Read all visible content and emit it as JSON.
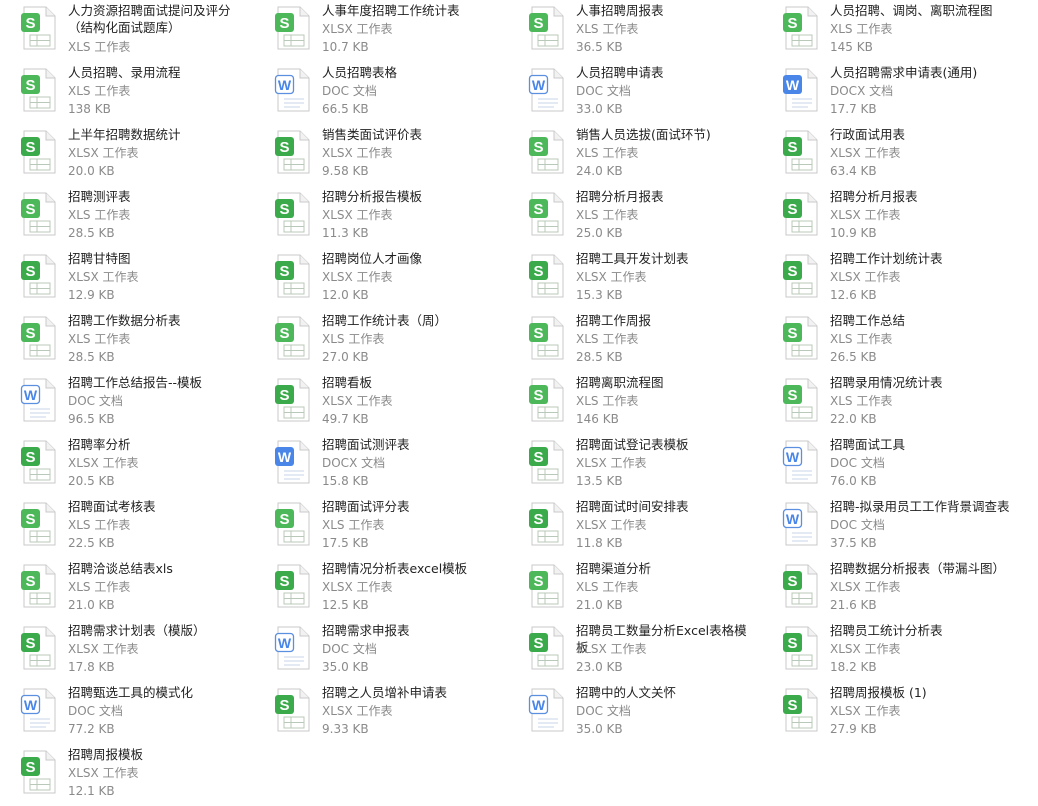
{
  "files": [
    {
      "name": "人力资源招聘面试提问及评分（结构化面试题库）",
      "type": "XLS 工作表",
      "size": "",
      "kind": "s"
    },
    {
      "name": "人事年度招聘工作统计表",
      "type": "XLSX 工作表",
      "size": "10.7 KB",
      "kind": "s"
    },
    {
      "name": "人事招聘周报表",
      "type": "XLS 工作表",
      "size": "36.5 KB",
      "kind": "s"
    },
    {
      "name": "人员招聘、调岗、离职流程图",
      "type": "XLS 工作表",
      "size": "145 KB",
      "kind": "s"
    },
    {
      "name": "人员招聘、录用流程",
      "type": "XLS 工作表",
      "size": "138 KB",
      "kind": "s"
    },
    {
      "name": "人员招聘表格",
      "type": "DOC 文档",
      "size": "66.5 KB",
      "kind": "w"
    },
    {
      "name": "人员招聘申请表",
      "type": "DOC 文档",
      "size": "33.0 KB",
      "kind": "w"
    },
    {
      "name": "人员招聘需求申请表(通用)",
      "type": "DOCX 文档",
      "size": "17.7 KB",
      "kind": "wx"
    },
    {
      "name": "上半年招聘数据统计",
      "type": "XLSX 工作表",
      "size": "20.0 KB",
      "kind": "sx"
    },
    {
      "name": "销售类面试评价表",
      "type": "XLSX 工作表",
      "size": "9.58 KB",
      "kind": "sx"
    },
    {
      "name": "销售人员选拔(面试环节)",
      "type": "XLS 工作表",
      "size": "24.0 KB",
      "kind": "s"
    },
    {
      "name": "行政面试用表",
      "type": "XLSX 工作表",
      "size": "63.4 KB",
      "kind": "sx"
    },
    {
      "name": "招聘测评表",
      "type": "XLS 工作表",
      "size": "28.5 KB",
      "kind": "s"
    },
    {
      "name": "招聘分析报告模板",
      "type": "XLSX 工作表",
      "size": "11.3 KB",
      "kind": "sx"
    },
    {
      "name": "招聘分析月报表",
      "type": "XLS 工作表",
      "size": "25.0 KB",
      "kind": "s"
    },
    {
      "name": "招聘分析月报表",
      "type": "XLSX 工作表",
      "size": "10.9 KB",
      "kind": "sx"
    },
    {
      "name": "招聘甘特图",
      "type": "XLSX 工作表",
      "size": "12.9 KB",
      "kind": "sx"
    },
    {
      "name": "招聘岗位人才画像",
      "type": "XLSX 工作表",
      "size": "12.0 KB",
      "kind": "sx"
    },
    {
      "name": "招聘工具开发计划表",
      "type": "XLSX 工作表",
      "size": "15.3 KB",
      "kind": "sx"
    },
    {
      "name": "招聘工作计划统计表",
      "type": "XLSX 工作表",
      "size": "12.6 KB",
      "kind": "sx"
    },
    {
      "name": "招聘工作数据分析表",
      "type": "XLS 工作表",
      "size": "28.5 KB",
      "kind": "s"
    },
    {
      "name": "招聘工作统计表（周）",
      "type": "XLS 工作表",
      "size": "27.0 KB",
      "kind": "s"
    },
    {
      "name": "招聘工作周报",
      "type": "XLS 工作表",
      "size": "28.5 KB",
      "kind": "s"
    },
    {
      "name": "招聘工作总结",
      "type": "XLS 工作表",
      "size": "26.5 KB",
      "kind": "s"
    },
    {
      "name": "招聘工作总结报告--模板",
      "type": "DOC 文档",
      "size": "96.5 KB",
      "kind": "w"
    },
    {
      "name": "招聘看板",
      "type": "XLSX 工作表",
      "size": "49.7 KB",
      "kind": "sx"
    },
    {
      "name": "招聘离职流程图",
      "type": "XLS 工作表",
      "size": "146 KB",
      "kind": "s"
    },
    {
      "name": "招聘录用情况统计表",
      "type": "XLS 工作表",
      "size": "22.0 KB",
      "kind": "s"
    },
    {
      "name": "招聘率分析",
      "type": "XLSX 工作表",
      "size": "20.5 KB",
      "kind": "sx"
    },
    {
      "name": "招聘面试测评表",
      "type": "DOCX 文档",
      "size": "15.8 KB",
      "kind": "wx"
    },
    {
      "name": "招聘面试登记表模板",
      "type": "XLSX 工作表",
      "size": "13.5 KB",
      "kind": "sx"
    },
    {
      "name": "招聘面试工具",
      "type": "DOC 文档",
      "size": "76.0 KB",
      "kind": "w"
    },
    {
      "name": "招聘面试考核表",
      "type": "XLS 工作表",
      "size": "22.5 KB",
      "kind": "s"
    },
    {
      "name": "招聘面试评分表",
      "type": "XLS 工作表",
      "size": "17.5 KB",
      "kind": "s"
    },
    {
      "name": "招聘面试时间安排表",
      "type": "XLSX 工作表",
      "size": "11.8 KB",
      "kind": "sx"
    },
    {
      "name": "招聘-拟录用员工工作背景调查表",
      "type": "DOC 文档",
      "size": "37.5 KB",
      "kind": "w"
    },
    {
      "name": "招聘洽谈总结表xls",
      "type": "XLS 工作表",
      "size": "21.0 KB",
      "kind": "s"
    },
    {
      "name": "招聘情况分析表excel模板",
      "type": "XLSX 工作表",
      "size": "12.5 KB",
      "kind": "sx"
    },
    {
      "name": "招聘渠道分析",
      "type": "XLS 工作表",
      "size": "21.0 KB",
      "kind": "s"
    },
    {
      "name": "招聘数据分析报表（带漏斗图）",
      "type": "XLSX 工作表",
      "size": "21.6 KB",
      "kind": "sx"
    },
    {
      "name": "招聘需求计划表（模版）",
      "type": "XLSX 工作表",
      "size": "17.8 KB",
      "kind": "sx"
    },
    {
      "name": "招聘需求申报表",
      "type": "DOC 文档",
      "size": "35.0 KB",
      "kind": "w"
    },
    {
      "name": "招聘员工数量分析Excel表格模板",
      "type": "XLSX 工作表",
      "size": "23.0 KB",
      "kind": "sx"
    },
    {
      "name": "招聘员工统计分析表",
      "type": "XLSX 工作表",
      "size": "18.2 KB",
      "kind": "sx"
    },
    {
      "name": "招聘甄选工具的模式化",
      "type": "DOC 文档",
      "size": "77.2 KB",
      "kind": "w"
    },
    {
      "name": "招聘之人员增补申请表",
      "type": "XLSX 工作表",
      "size": "9.33 KB",
      "kind": "sx"
    },
    {
      "name": "招聘中的人文关怀",
      "type": "DOC 文档",
      "size": "35.0 KB",
      "kind": "w"
    },
    {
      "name": "招聘周报模板 (1)",
      "type": "XLSX 工作表",
      "size": "27.9 KB",
      "kind": "sx"
    },
    {
      "name": "招聘周报模板",
      "type": "XLSX 工作表",
      "size": "12.1 KB",
      "kind": "sx"
    }
  ],
  "colors": {
    "sheet_green": "#3aaa4a",
    "sheet_green_light": "#4cb85a",
    "doc_blue": "#4a86e8",
    "doc_blue_outline": "#5b8fe0"
  },
  "icons": {
    "s": "spreadsheet-icon",
    "sx": "spreadsheet-icon",
    "w": "document-icon",
    "wx": "document-icon"
  }
}
